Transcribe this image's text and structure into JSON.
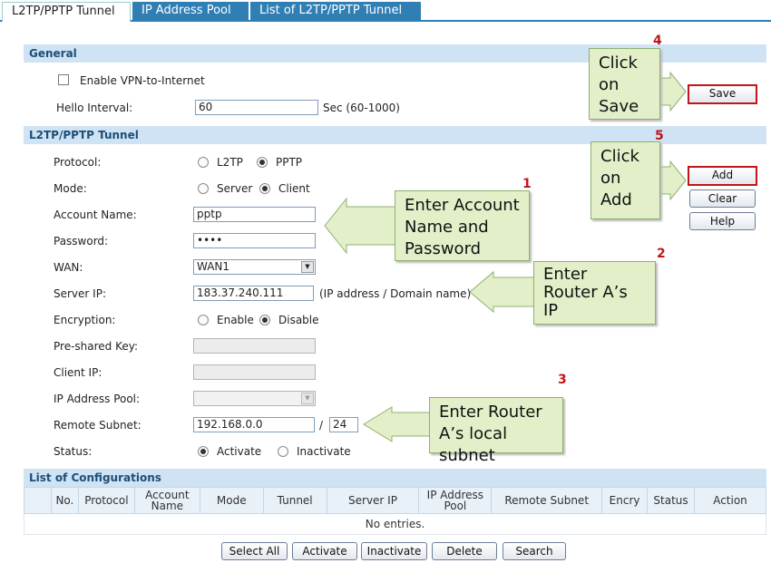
{
  "tabs": [
    {
      "label": "L2TP/PPTP Tunnel"
    },
    {
      "label": "IP Address Pool"
    },
    {
      "label": "List of L2TP/PPTP Tunnel"
    }
  ],
  "general": {
    "title": "General",
    "enable_vpn_label": "Enable VPN-to-Internet",
    "hello_interval_label": "Hello Interval:",
    "hello_interval_value": "60",
    "hello_interval_hint": "Sec (60-1000)"
  },
  "tunnel": {
    "title": "L2TP/PPTP Tunnel",
    "protocol_label": "Protocol:",
    "protocol_options": [
      "L2TP",
      "PPTP"
    ],
    "mode_label": "Mode:",
    "mode_options": [
      "Server",
      "Client"
    ],
    "account_label": "Account Name:",
    "account_value": "pptp",
    "password_label": "Password:",
    "password_value": "••••",
    "wan_label": "WAN:",
    "wan_value": "WAN1",
    "server_ip_label": "Server IP:",
    "server_ip_value": "183.37.240.111",
    "server_ip_hint": "(IP address / Domain name)",
    "encryption_label": "Encryption:",
    "encryption_options": [
      "Enable",
      "Disable"
    ],
    "psk_label": "Pre-shared Key:",
    "client_ip_label": "Client IP:",
    "pool_label": "IP Address Pool:",
    "remote_subnet_label": "Remote Subnet:",
    "remote_subnet_value": "192.168.0.0",
    "slash": "/",
    "mask_value": "24",
    "status_label": "Status:",
    "status_options": [
      "Activate",
      "Inactivate"
    ]
  },
  "side_buttons": {
    "save": "Save",
    "add": "Add",
    "clear": "Clear",
    "help": "Help"
  },
  "callouts": [
    {
      "step": "4",
      "text": [
        "Click",
        "on",
        "Save"
      ]
    },
    {
      "step": "5",
      "text": [
        "Click",
        "on",
        "Add"
      ]
    },
    {
      "step": "1",
      "text": [
        "Enter Account",
        "Name and",
        "Password"
      ]
    },
    {
      "step": "2",
      "text": [
        "Enter",
        "Router A’s",
        "IP"
      ]
    },
    {
      "step": "3",
      "text": [
        "Enter Router",
        "A’s local subnet"
      ]
    }
  ],
  "list": {
    "title": "List of Configurations",
    "columns": [
      "",
      "No.",
      "Protocol",
      "Account Name",
      "Mode",
      "Tunnel",
      "Server IP",
      "IP Address Pool",
      "Remote Subnet",
      "Encry",
      "Status",
      "Action"
    ],
    "empty": "No entries."
  },
  "bottom_buttons": [
    "Select All",
    "Activate",
    "Inactivate",
    "Delete",
    "Search"
  ],
  "colors": {
    "tab_blue": "#2f7fb5",
    "section_bg": "#cfe3f4",
    "callout_bg": "#e3efc9",
    "highlight_red": "#c0151b"
  }
}
